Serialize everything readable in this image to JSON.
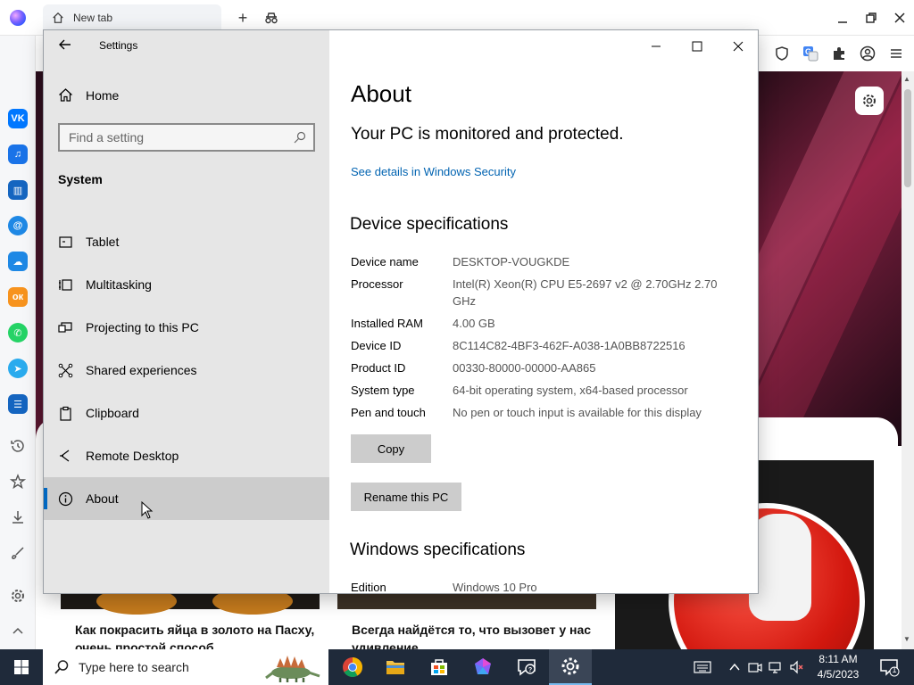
{
  "browser": {
    "tab_title": "New tab",
    "new_tab_symbol": "+",
    "sidebar_apps": [
      {
        "name": "vk",
        "label": "VK",
        "color": "#0077ff"
      },
      {
        "name": "music",
        "label": "♫",
        "color": "#1a73e8"
      },
      {
        "name": "stats",
        "label": "▥",
        "color": "#1565c0"
      },
      {
        "name": "mail",
        "label": "@",
        "color": "#1e88e5"
      },
      {
        "name": "cloud",
        "label": "☁",
        "color": "#1e88e5"
      },
      {
        "name": "ok",
        "label": "ок",
        "color": "#f7931e"
      },
      {
        "name": "whatsapp",
        "label": "✆",
        "color": "#25d366"
      },
      {
        "name": "telegram",
        "label": "➤",
        "color": "#2aabee"
      },
      {
        "name": "list",
        "label": "☰",
        "color": "#1565c0"
      }
    ]
  },
  "news": {
    "item1": "Как покрасить яйца в золото на Пасху, очень простой способ",
    "item2": "Всегда найдётся то, что вызовет у нас удивление"
  },
  "settings": {
    "window_title": "Settings",
    "home_label": "Home",
    "search_placeholder": "Find a setting",
    "section_label": "System",
    "nav_items": [
      {
        "label": "Tablet",
        "icon": "tablet-icon"
      },
      {
        "label": "Multitasking",
        "icon": "multitasking-icon"
      },
      {
        "label": "Projecting to this PC",
        "icon": "projecting-icon"
      },
      {
        "label": "Shared experiences",
        "icon": "shared-experiences-icon"
      },
      {
        "label": "Clipboard",
        "icon": "clipboard-icon"
      },
      {
        "label": "Remote Desktop",
        "icon": "remote-desktop-icon"
      },
      {
        "label": "About",
        "icon": "info-icon",
        "active": true
      }
    ],
    "page_title": "About",
    "protection_text": "Your PC is monitored and protected.",
    "security_link": "See details in Windows Security",
    "device_heading": "Device specifications",
    "device_specs": [
      {
        "key": "Device name",
        "value": "DESKTOP-VOUGKDE"
      },
      {
        "key": "Processor",
        "value": "Intel(R) Xeon(R) CPU E5-2697 v2 @ 2.70GHz   2.70 GHz"
      },
      {
        "key": "Installed RAM",
        "value": "4.00 GB"
      },
      {
        "key": "Device ID",
        "value": "8C114C82-4BF3-462F-A038-1A0BB8722516"
      },
      {
        "key": "Product ID",
        "value": "00330-80000-00000-AA865"
      },
      {
        "key": "System type",
        "value": "64-bit operating system, x64-based processor"
      },
      {
        "key": "Pen and touch",
        "value": "No pen or touch input is available for this display"
      }
    ],
    "copy_button": "Copy",
    "rename_button": "Rename this PC",
    "windows_heading": "Windows specifications",
    "windows_specs": [
      {
        "key": "Edition",
        "value": "Windows 10 Pro"
      }
    ]
  },
  "taskbar": {
    "search_placeholder": "Type here to search",
    "time": "8:11 AM",
    "date": "4/5/2023",
    "notification_count": "1"
  }
}
